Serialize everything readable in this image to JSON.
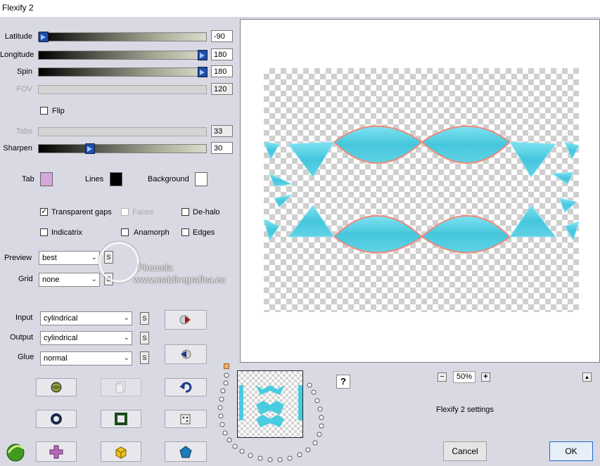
{
  "window": {
    "title": "Flexify 2"
  },
  "sliders": [
    {
      "label": "Latitude",
      "value": "-90",
      "enabled": true,
      "level": 0.0
    },
    {
      "label": "Longitude",
      "value": "180",
      "enabled": true,
      "level": 1.0
    },
    {
      "label": "Spin",
      "value": "180",
      "enabled": true,
      "level": 1.0
    },
    {
      "label": "FOV",
      "value": "120",
      "enabled": false
    },
    {
      "label": "Tabs",
      "value": "33",
      "enabled": false
    },
    {
      "label": "Sharpen",
      "value": "30",
      "enabled": true,
      "level": 0.3
    }
  ],
  "flip": {
    "label": "Flip",
    "checked": false
  },
  "colors": {
    "tab": {
      "label": "Tab",
      "color": "#d3a7d9"
    },
    "lines": {
      "label": "Lines",
      "color": "#000000"
    },
    "background": {
      "label": "Background",
      "color": "#ffffff"
    }
  },
  "options": {
    "transparent_gaps": {
      "label": "Transparent gaps",
      "checked": true
    },
    "faces": {
      "label": "Faces",
      "checked": false
    },
    "de_halo": {
      "label": "De-halo",
      "checked": false
    },
    "indicatrix": {
      "label": "Indicatrix",
      "checked": false
    },
    "anamorph": {
      "label": "Anamorph",
      "checked": false
    },
    "edges": {
      "label": "Edges",
      "checked": false
    }
  },
  "preview": {
    "label": "Preview",
    "value": "best",
    "s": "S"
  },
  "grid": {
    "label": "Grid",
    "value": "none",
    "s": "S"
  },
  "input": {
    "label": "Input",
    "value": "cylindrical",
    "s": "S"
  },
  "output": {
    "label": "Output",
    "value": "cylindrical",
    "s": "S"
  },
  "glue": {
    "label": "Glue",
    "value": "normal",
    "s": "S"
  },
  "watermark": {
    "line1": "Pinuccia",
    "line2": "www.maidiregrafica.eu"
  },
  "zoom": {
    "value": "50%",
    "minus": "−",
    "plus": "+"
  },
  "help": "?",
  "settings_label": "Flexify 2 settings",
  "scroll_up": "▲",
  "buttons": {
    "cancel": "Cancel",
    "ok": "OK"
  },
  "icons": [
    "forward-play-icon",
    "rewind-icon",
    "globe-icon",
    "copy-icon",
    "undo-icon",
    "ring-icon",
    "frame-icon",
    "dice-icon",
    "cross-icon",
    "cube-icon",
    "pentagon-icon"
  ]
}
